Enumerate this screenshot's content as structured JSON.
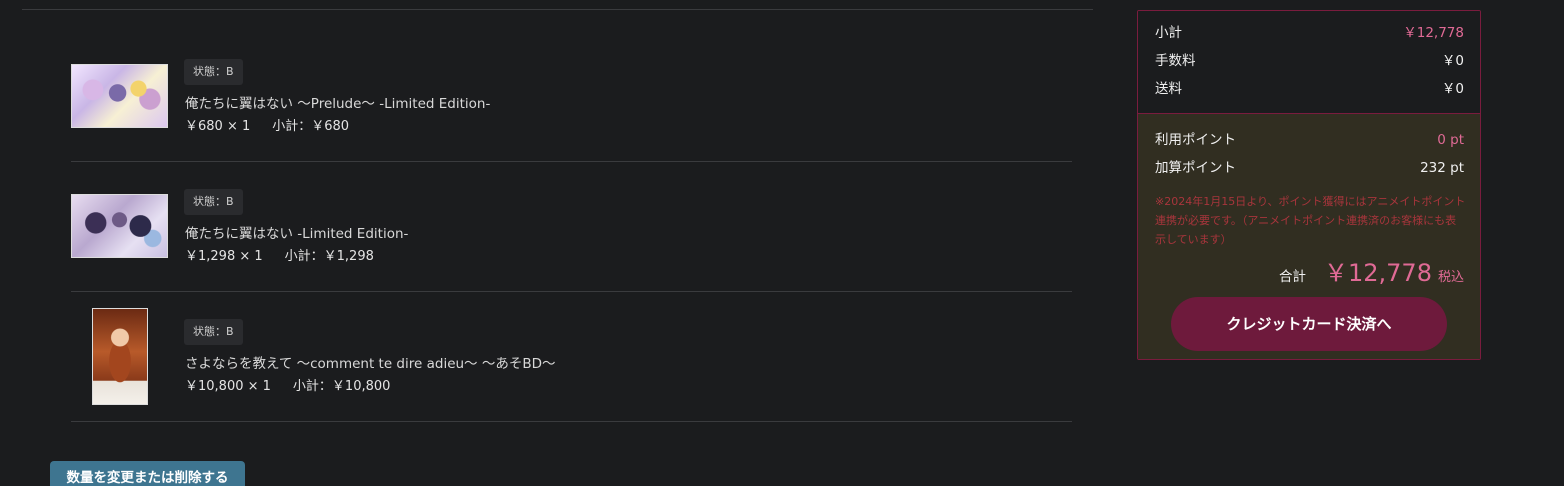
{
  "cart": {
    "items": [
      {
        "state": "状態：B",
        "title": "俺たちに翼はない 〜Prelude〜 -Limited Edition-",
        "price": "￥680 × 1",
        "subtotal": "小計：￥680"
      },
      {
        "state": "状態：B",
        "title": "俺たちに翼はない -Limited Edition-",
        "price": "￥1,298 × 1",
        "subtotal": "小計：￥1,298"
      },
      {
        "state": "状態：B",
        "title": "さよならを教えて 〜comment te dire adieu〜 〜あそBD〜",
        "price": "￥10,800 × 1",
        "subtotal": "小計：￥10,800"
      }
    ],
    "change_button": "数量を変更または削除する"
  },
  "summary": {
    "subtotal_label": "小計",
    "subtotal_value": "￥12,778",
    "fee_label": "手数料",
    "fee_value": "￥0",
    "shipping_label": "送料",
    "shipping_value": "￥0",
    "used_points_label": "利用ポイント",
    "used_points_value": "0 pt",
    "added_points_label": "加算ポイント",
    "added_points_value": "232 pt",
    "notice": "※2024年1月15日より、ポイント獲得にはアニメイトポイント連携が必要です。（アニメイトポイント連携済のお客様にも表示しています）",
    "total_label": "合計",
    "total_value": "￥12,778",
    "total_tax": "税込",
    "credit_button": "クレジットカード決済へ"
  },
  "colors": {
    "accent_pink": "#e06a95",
    "button_wine": "#6e1a3c",
    "button_blue": "#3e7590",
    "panel_border": "#7a1c3e"
  }
}
